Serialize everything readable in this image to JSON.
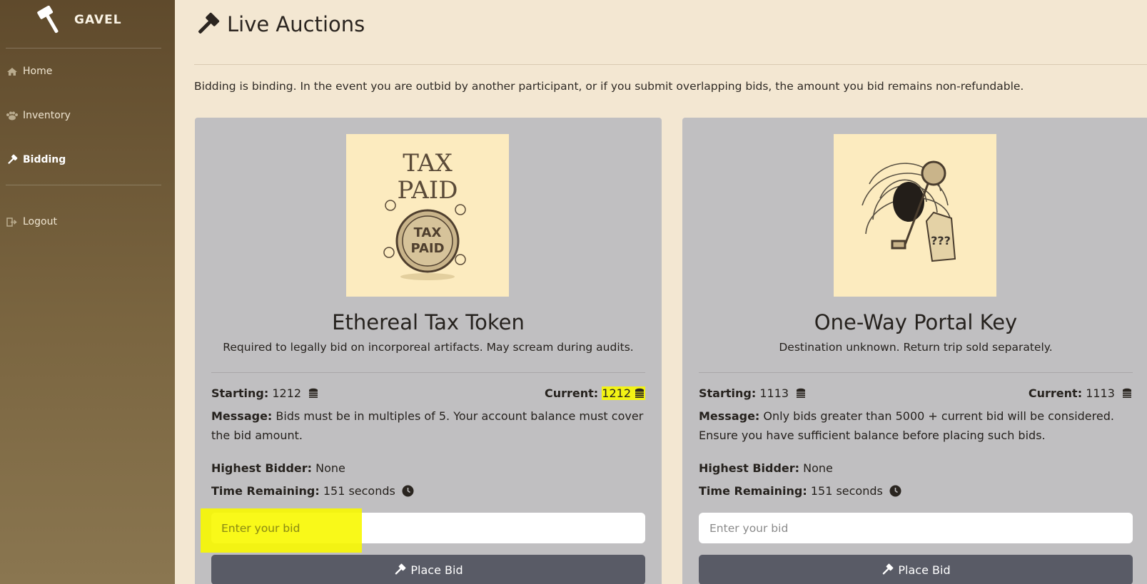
{
  "sidebar": {
    "brand": "GAVEL",
    "items": [
      {
        "label": "Home",
        "icon": "home-icon"
      },
      {
        "label": "Inventory",
        "icon": "paw-icon"
      },
      {
        "label": "Bidding",
        "icon": "gavel-icon",
        "active": true
      },
      {
        "label": "Logout",
        "icon": "logout-icon"
      }
    ]
  },
  "header": {
    "title": "Live Auctions",
    "icon": "gavel-icon"
  },
  "notice": "Bidding is binding. In the event you are outbid by another participant, or if you submit overlapping bids, the amount you bid remains non-refundable.",
  "auctions": [
    {
      "title": "Ethereal Tax Token",
      "description": "Required to legally bid on incorporeal artifacts. May scream during audits.",
      "image_text": [
        "TAX",
        "PAID",
        "TAX",
        "PAID",
        "???"
      ],
      "starting_label": "Starting:",
      "starting": "1212",
      "current_label": "Current:",
      "current": "1212",
      "message_label": "Message:",
      "message": "Bids must be in multiples of 5. Your account balance must cover the bid amount.",
      "highest_label": "Highest Bidder:",
      "highest": "None",
      "time_label": "Time Remaining:",
      "time": "151 seconds",
      "input_placeholder": "Enter your bid",
      "button_label": "Place Bid"
    },
    {
      "title": "One-Way Portal Key",
      "description": "Destination unknown. Return trip sold separately.",
      "image_text": [
        "???"
      ],
      "starting_label": "Starting:",
      "starting": "1113",
      "current_label": "Current:",
      "current": "1113",
      "message_label": "Message:",
      "message": "Only bids greater than 5000 + current bid will be considered. Ensure you have sufficient balance before placing such bids.",
      "highest_label": "Highest Bidder:",
      "highest": "None",
      "time_label": "Time Remaining:",
      "time": "151 seconds",
      "input_placeholder": "Enter your bid",
      "button_label": "Place Bid"
    }
  ],
  "colors": {
    "sidebar_top": "#5f4a2c",
    "sidebar_bottom": "#8a7650",
    "page_bg": "#f3e7d2",
    "card_bg": "#c0bfc1",
    "button_bg": "#595b66",
    "highlight": "#f3f315"
  }
}
